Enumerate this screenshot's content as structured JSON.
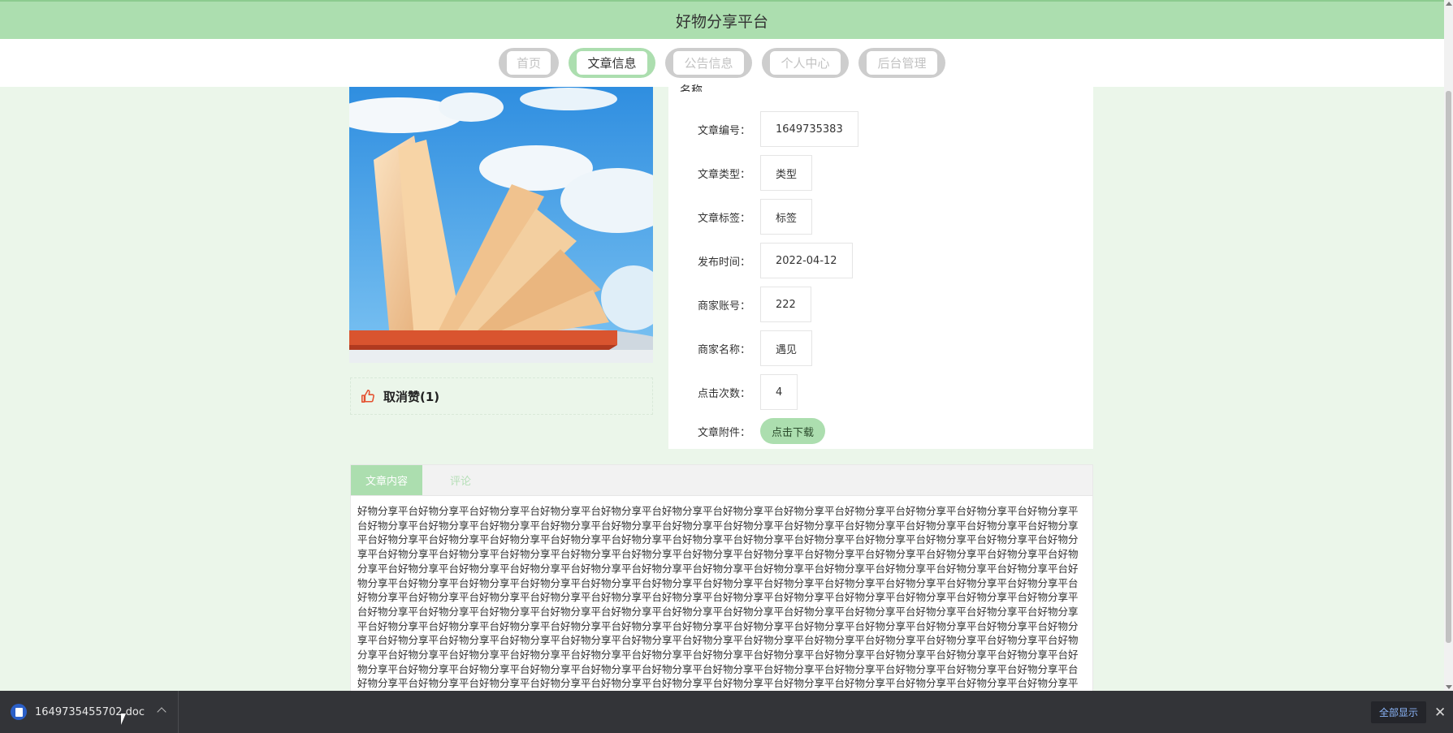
{
  "header": {
    "title": "好物分享平台"
  },
  "nav": [
    {
      "label": "首页",
      "active": false
    },
    {
      "label": "文章信息",
      "active": true
    },
    {
      "label": "公告信息",
      "active": false
    },
    {
      "label": "个人中心",
      "active": false
    },
    {
      "label": "后台管理",
      "active": false
    }
  ],
  "info": {
    "cutoff_label": "名称",
    "fields": [
      {
        "label": "文章编号：",
        "value": "1649735383"
      },
      {
        "label": "文章类型：",
        "value": "类型"
      },
      {
        "label": "文章标签：",
        "value": "标签"
      },
      {
        "label": "发布时间：",
        "value": "2022-04-12"
      },
      {
        "label": "商家账号：",
        "value": "222"
      },
      {
        "label": "商家名称：",
        "value": "遇见"
      },
      {
        "label": "点击次数：",
        "value": "4"
      }
    ],
    "attachment": {
      "label": "文章附件：",
      "button": "点击下载"
    }
  },
  "like": {
    "label": "取消赞(1)"
  },
  "content": {
    "tabs": [
      {
        "label": "文章内容",
        "active": true
      },
      {
        "label": "评论",
        "active": false
      }
    ],
    "text": "好物分享平台好物分享平台好物分享平台好物分享平台好物分享平台好物分享平台好物分享平台好物分享平台好物分享平台好物分享平台好物分享平台好物分享平台好物分享平台好物分享平台好物分享平台好物分享平台好物分享平台好物分享平台好物分享平台好物分享平台好物分享平台好物分享平台好物分享平台好物分享平台好物分享平台好物分享平台好物分享平台好物分享平台好物分享平台好物分享平台好物分享平台好物分享平台好物分享平台好物分享平台好物分享平台好物分享平台好物分享平台好物分享平台好物分享平台好物分享平台好物分享平台好物分享平台好物分享平台好物分享平台好物分享平台好物分享平台好物分享平台好物分享平台好物分享平台好物分享平台好物分享平台好物分享平台好物分享平台好物分享平台好物分享平台好物分享平台好物分享平台好物分享平台好物分享平台好物分享平台好物分享平台好物分享平台好物分享平台好物分享平台好物分享平台好物分享平台好物分享平台好物分享平台好物分享平台好物分享平台好物分享平台好物分享平台好物分享平台好物分享平台好物分享平台好物分享平台好物分享平台好物分享平台好物分享平台好物分享平台好物分享平台好物分享平台好物分享平台好物分享平台好物分享平台好物分享平台好物分享平台好物分享平台好物分享平台好物分享平台好物分享平台好物分享平台好物分享平台好物分享平台好物分享平台好物分享平台好物分享平台好物分享平台好物分享平台好物分享平台好物分享平台好物分享平台好物分享平台好物分享平台好物分享平台好物分享平台好物分享平台好物分享平台好物分享平台好物分享平台好物分享平台好物分享平台好物分享平台好物分享平台好物分享平台好物分享平台好物分享平台好物分享平台好物分享平台好物分享平台好物分享平台好物分享平台好物分享平台好物分享平台好物分享平台好物分享平台好物分享平台好物分享平台好物分享平台好物分享平台好物分享平台好物分享平台好物分享平台好物分享平台好物分享平台好物分享平台好物分享平台好物分享平台好物分享平台好物分享平台好物分享平台好物分享平台好物分享平台好物分享平台好物分享平台好物分享平台好物分享平台好物分享平台好物分享平台好物分享平台好物分享平台好物分享平台好物分享平台好物分享平台好物分享平台好物分享平台好物分享平台好物分享平台好物分享平台好物分享平台好物分享平台好物分享平台好物分享平台好物分享平台好物分享平台好物分享平台好物分享平台好物分享平台好物分享平台好物分享平台好物分享平台好物分享平台好物分享平台好物分享平台好物分享平台好物分享平台好物分享平台好物分享平台好物分享平台好物分享平台"
  },
  "download_bar": {
    "filename": "1649735455702.doc",
    "show_all": "全部显示",
    "close": "✕"
  },
  "colors": {
    "accent": "#acdeaf",
    "page_bg": "#ebf6ea",
    "nav_inactive": "#cdcdcd",
    "like_icon": "#e4502f",
    "download_bar_bg": "#333438"
  },
  "icons": {
    "like": "thumbs-up-icon",
    "file": "word-doc-icon",
    "expand": "chevron-up-icon",
    "close": "close-icon"
  }
}
